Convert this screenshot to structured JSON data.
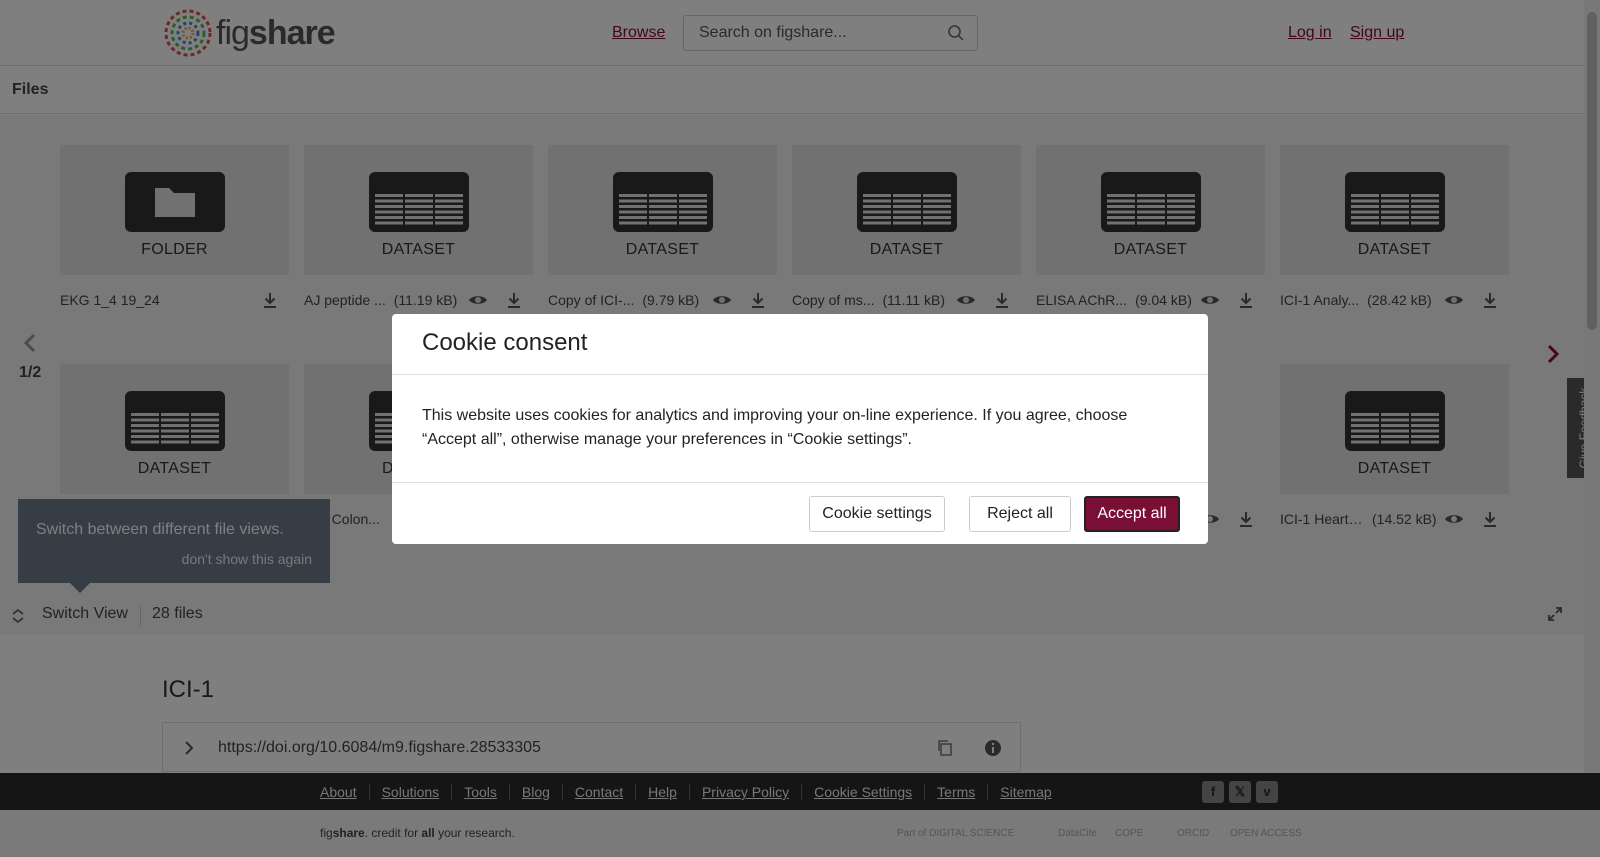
{
  "header": {
    "logo_text_light": "fig",
    "logo_text_bold": "share",
    "browse_label": "Browse",
    "search_placeholder": "Search on figshare...",
    "login_label": "Log in",
    "signup_label": "Sign up",
    "accent_color": "#8a0c3a"
  },
  "files": {
    "title": "Files",
    "page_indicator": "1/2",
    "row1": [
      {
        "type": "FOLDER",
        "icon": "folder-icon",
        "name": "EKG 1_4 19_24",
        "size": ""
      },
      {
        "type": "DATASET",
        "icon": "dataset-icon",
        "name": "AJ peptide ...",
        "size": "(11.19 kB)"
      },
      {
        "type": "DATASET",
        "icon": "dataset-icon",
        "name": "Copy of ICI-...",
        "size": "(9.79 kB)"
      },
      {
        "type": "DATASET",
        "icon": "dataset-icon",
        "name": "Copy of ms...",
        "size": "(11.11 kB)"
      },
      {
        "type": "DATASET",
        "icon": "dataset-icon",
        "name": "ELISA AChR...",
        "size": "(9.04 kB)"
      },
      {
        "type": "DATASET",
        "icon": "dataset-icon",
        "name": "ICI-1 Analy...",
        "size": "(28.42 kB)"
      }
    ],
    "row2": [
      {
        "type": "DATASET",
        "icon": "dataset-icon",
        "name": "",
        "size": ""
      },
      {
        "type": "DATASET",
        "icon": "dataset-icon",
        "name": "1 Colon...",
        "size": ""
      },
      {
        "type": "DATASET",
        "icon": "dataset-icon",
        "name": "ICI-1 Heart ...",
        "size": "(14.52 kB)"
      }
    ],
    "row2_partial_type": "D",
    "tooltip_text": "Switch between different file views.",
    "tooltip_dismiss": "don't show this again",
    "switch_view_label": "Switch View",
    "file_count": "28 files"
  },
  "feedback_label": "Give Feedback",
  "item": {
    "title": "ICI-1",
    "doi": "https://doi.org/10.6084/m9.figshare.28533305"
  },
  "footer": {
    "links": [
      "About",
      "Solutions",
      "Tools",
      "Blog",
      "Contact",
      "Help",
      "Privacy Policy",
      "Cookie Settings",
      "Terms",
      "Sitemap"
    ],
    "social": [
      "facebook-icon",
      "x-icon",
      "vimeo-icon"
    ],
    "tagline_fig": "fig",
    "tagline_share": "share",
    "tagline_mid": ". credit for ",
    "tagline_all": "all",
    "tagline_end": " your research.",
    "partners": [
      "Part of DIGITAL SCIENCE",
      "DataCite",
      "COPE",
      "ORCID",
      "OPEN ACCESS"
    ]
  },
  "cookie_modal": {
    "title": "Cookie consent",
    "body": "This website uses cookies for analytics and improving your on-line experience. If you agree, choose “Accept all”, otherwise manage your preferences in “Cookie settings”.",
    "settings_label": "Cookie settings",
    "reject_label": "Reject all",
    "accept_label": "Accept all",
    "accept_color": "#7a0f36"
  }
}
